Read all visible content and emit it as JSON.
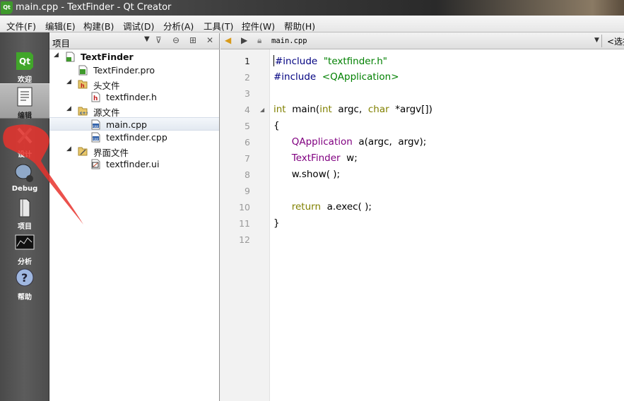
{
  "window": {
    "title": "main.cpp - TextFinder - Qt Creator",
    "app_icon": "qt-logo-icon"
  },
  "menu": [
    "文件(F)",
    "编辑(E)",
    "构建(B)",
    "调试(D)",
    "分析(A)",
    "工具(T)",
    "控件(W)",
    "帮助(H)"
  ],
  "modes": [
    {
      "id": "welcome",
      "label": "欢迎",
      "icon": "qt-logo-icon",
      "active": false
    },
    {
      "id": "edit",
      "label": "编辑",
      "icon": "document-icon",
      "active": true
    },
    {
      "id": "design",
      "label": "设计",
      "icon": "design-tools-icon",
      "active": false
    },
    {
      "id": "debug",
      "label": "Debug",
      "icon": "bug-icon",
      "active": false
    },
    {
      "id": "projects",
      "label": "项目",
      "icon": "folder-icon",
      "active": false
    },
    {
      "id": "analyze",
      "label": "分析",
      "icon": "analyze-monitor-icon",
      "active": false
    },
    {
      "id": "help",
      "label": "帮助",
      "icon": "help-icon",
      "active": false
    }
  ],
  "project_panel": {
    "title": "项目",
    "tree": [
      {
        "label": "TextFinder",
        "level": 0,
        "expanded": true,
        "icon": "project-icon",
        "bold": true
      },
      {
        "label": "TextFinder.pro",
        "level": 1,
        "icon": "pro-file-icon"
      },
      {
        "label": "头文件",
        "level": 1,
        "expanded": true,
        "icon": "header-folder-icon"
      },
      {
        "label": "textfinder.h",
        "level": 2,
        "icon": "header-file-icon"
      },
      {
        "label": "源文件",
        "level": 1,
        "expanded": true,
        "icon": "source-folder-icon"
      },
      {
        "label": "main.cpp",
        "level": 2,
        "icon": "cpp-file-icon",
        "selected": true
      },
      {
        "label": "textfinder.cpp",
        "level": 2,
        "icon": "cpp-file-icon"
      },
      {
        "label": "界面文件",
        "level": 1,
        "expanded": true,
        "icon": "forms-folder-icon"
      },
      {
        "label": "textfinder.ui",
        "level": 2,
        "icon": "ui-file-icon"
      }
    ]
  },
  "editor": {
    "file_name": "main.cpp",
    "symbol_placeholder": "<选择符号>",
    "current_line": 1,
    "lines": [
      [
        [
          "#include",
          "pp"
        ],
        [
          "  ",
          ""
        ],
        [
          "\"textfinder.h\"",
          "str"
        ]
      ],
      [
        [
          "#include",
          "pp"
        ],
        [
          "  ",
          ""
        ],
        [
          "<QApplication>",
          "str"
        ]
      ],
      [],
      [
        [
          "int",
          "kw"
        ],
        [
          "  main(",
          ""
        ],
        [
          "int",
          "kw"
        ],
        [
          "  argc,  ",
          ""
        ],
        [
          "char",
          "kw"
        ],
        [
          "  *argv[])",
          ""
        ]
      ],
      [
        [
          "{",
          ""
        ]
      ],
      [
        [
          "      ",
          ""
        ],
        [
          "QApplication",
          "type"
        ],
        [
          "  a(argc,  argv);",
          ""
        ]
      ],
      [
        [
          "      ",
          ""
        ],
        [
          "TextFinder",
          "type"
        ],
        [
          "  w;",
          ""
        ]
      ],
      [
        [
          "      w.show( );",
          ""
        ]
      ],
      [],
      [
        [
          "      ",
          ""
        ],
        [
          "return",
          "kw"
        ],
        [
          "  a.exec( );",
          ""
        ]
      ],
      [
        [
          "}",
          ""
        ]
      ],
      []
    ],
    "fold_markers": [
      4
    ]
  },
  "colors": {
    "preprocessor": "#000080",
    "string": "#008000",
    "keyword": "#808000",
    "type": "#800080",
    "annotation": "#e8322d"
  }
}
